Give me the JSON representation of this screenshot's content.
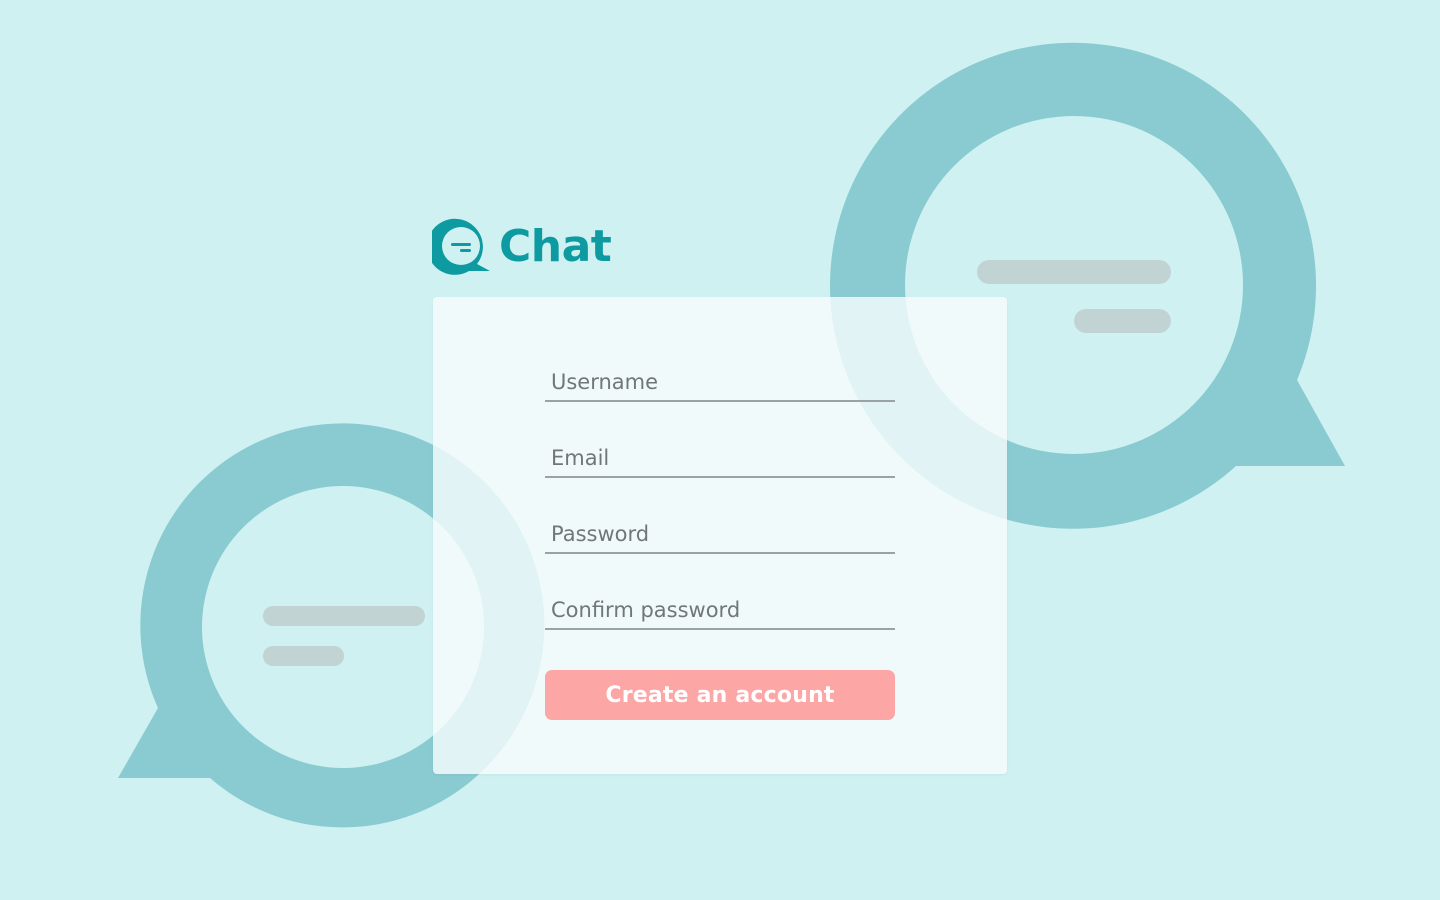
{
  "app": {
    "name": "Chat",
    "logo_icon": "chat-bubble-icon"
  },
  "form": {
    "username_placeholder": "Username",
    "email_placeholder": "Email",
    "password_placeholder": "Password",
    "confirm_password_placeholder": "Confirm password",
    "submit_label": "Create an account"
  },
  "colors": {
    "background": "#cff1f2",
    "brand": "#0d9aa1",
    "bubble": "#89cbd1",
    "card": "#f7fcfd",
    "button": "#fca6a6",
    "placeholder_lines": "#c2d3d4"
  }
}
